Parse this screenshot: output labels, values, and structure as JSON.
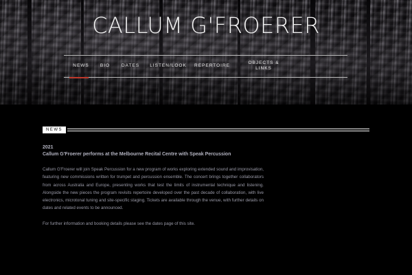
{
  "site": {
    "title": "CALLUM G'FROERER"
  },
  "nav": {
    "items": [
      {
        "label": "NEWS"
      },
      {
        "label": "BIO"
      },
      {
        "label": "DATES"
      },
      {
        "label": "LISTEN/LOOK"
      },
      {
        "label": "REPERTOIRE"
      },
      {
        "label": "OBJECTS &",
        "label2": "LINKS"
      }
    ],
    "active": "NEWS"
  },
  "section": {
    "label": "NEWS"
  },
  "post": {
    "date": "2021",
    "title": "Callum G'Froerer performs at the Melbourne Recital Centre with Speak Percussion",
    "body": "Callum G'Froerer will join Speak Percussion for a new program of works exploring extended sound and improvisation, featuring new commissions written for trumpet and percussion ensemble. The concert brings together collaborators from across Australia and Europe, presenting works that test the limits of instrumental technique and listening. Alongside the new pieces the program revisits repertoire developed over the past decade of collaboration, with live electronics, microtonal tuning and site-specific staging. Tickets are available through the venue, with further details on dates and related events to be announced.",
    "footer": "For further information and booking details please see the dates page of this site."
  },
  "colors": {
    "background": "#000000",
    "accent": "#c0392b",
    "body_text": "#9a9aa8"
  }
}
